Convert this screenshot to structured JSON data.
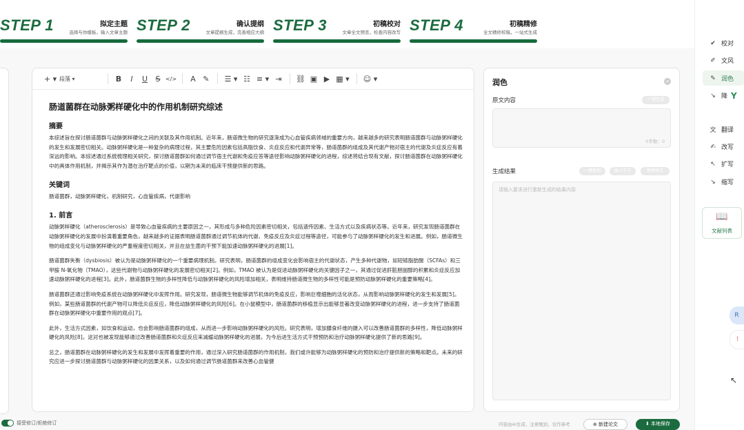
{
  "steps": [
    {
      "num": "STEP 1",
      "title": "拟定主题",
      "subtitle": "选择与你模板，输入文章主题"
    },
    {
      "num": "STEP 2",
      "title": "确认提纲",
      "subtitle": "文章提纲生成，完善相应大纲"
    },
    {
      "num": "STEP 3",
      "title": "初稿校对",
      "subtitle": "文章全文预览，检查内容改写"
    },
    {
      "num": "STEP 4",
      "title": "初稿精修",
      "subtitle": "全文精修校稿，一站式生成"
    }
  ],
  "toolbar": {
    "add": "+ ▾",
    "paragraph": "段落 ▾",
    "bold": "B",
    "italic": "I",
    "underline": "U",
    "strike": "S",
    "code": "</>",
    "font_color": "A",
    "highlight": "✎",
    "align": "☰ ▾",
    "list": "☷",
    "ordered_list": "≡ ▾",
    "indent": "⇥",
    "link": "⛓",
    "image": "▣",
    "video": "▶",
    "table": "▦ ▾",
    "emoji": "☺ ▾"
  },
  "document": {
    "title": "肠道菌群在动脉粥样硬化中的作用机制研究综述",
    "abstract_heading": "摘要",
    "abstract": "本综述旨在探讨肠道菌群与动脉粥样硬化之间的关联及其作用机制。近年来，肠道微生物的研究逐渐成为心血管疾病领域的重要方向，越来越多的研究表明肠道菌群与动脉粥样硬化的发生和发展密切相关。动脉粥样硬化是一种复杂的病理过程，其主要危险因素包括高脂饮食、炎症反应和代谢异常等，肠道菌群的组成及其代谢产物对宿主的代谢及炎症反应有着深远的影响。本综述通过系统梳理相关研究，探讨肠道菌群如何通过调节宿主代谢和免疫应答等途径影响动脉粥样硬化的进程，综述将结合现有文献，探讨肠道菌群在动脉粥样硬化中的具体作用机制，并揭示其作为潜在治疗靶点的价值，以期为未来的临床干预提供新的思路。",
    "keywords_heading": "关键词",
    "keywords": "肠道菌群，动脉粥样硬化，机制研究，心血管疾病，代谢影响",
    "section1_heading": "1. 前言",
    "paragraphs": [
      "动脉粥样硬化（atherosclerosis）是导致心血管疾病的主要原因之一，其形成与多种危险因素密切相关，包括遗传因素、生活方式以及疾病状态等。近年来，研究发现肠道菌群在动脉粥样硬化的发展中扮演着重要角色，越来越多的证据表明肠道菌群通过调节机体的代谢、免疫反应及炎症过程等途径，可能参与了动脉粥样硬化的发生和进展。例如，肠道微生物的组成变化与动脉粥样硬化的严重程度密切相关，并且在益生菌的干预下能加速动脉粥样硬化的进展[1]。",
      "肠道菌群失衡（dysbiosis）被认为是动脉粥样硬化的一个重要病理机制。研究表明，肠道菌群的组成变化会影响宿主的代谢状态，产生多种代谢物，如短链脂肪酸（SCFAs）和三甲胺 N-氧化物（TMAO），这些代谢物与动脉粥样硬化的发展密切相关[2]。例如，TMAO 被认为是促进动脉粥样硬化的关键因子之一，其通过促进肝脏胆固醇的积累和炎症反应加速动脉粥样硬化的进程[3]。此外，肠道菌群生物的多样性降低与动脉粥样硬化的风险增加相关，表明维持肠道微生物的多样性可能是预防动脉粥样硬化的重要策略[4]。",
      "肠道菌群还通过影响免疫系统在动脉粥样硬化中发挥作用。研究发现，肠道微生物能够调节机体的免疫反应，影响巨噬细胞的活化状态，从而影响动脉粥样硬化的发生和发展[5]。例如，某些肠道菌群的代谢产物可以降低炎症反应，降低动脉粥样硬化的风险[6]。在小鼠模型中，肠道菌群的移植显示出能够显著改变动脉粥样硬化的进程，进一步支持了肠道菌群在动脉粥样硬化中重要作用的观点[7]。",
      "此外，生活方式因素，如饮食和运动，也会影响肠道菌群的组成，从而进一步影响动脉粥样硬化的风险。研究表明，增加膳食纤维的摄入可以改善肠道菌群的多样性，降低动脉粥样硬化的风险[8]。这对也被发现能够通过改善肠道菌群和炎症反应来减缓动脉粥样硬化的进展，为今后进生活方式干预预防和治疗动脉粥样硬化提供了新的思路[9]。",
      "总之，肠道菌群在动脉粥样硬化的发生和发展中发挥着重要的作用，通过深入研究肠道菌群的作用机制，我们或许能够为动脉粥样硬化的预防和治疗提供新的策略和靶点。未来的研究应进一步探讨肠道菌群与动脉粥样硬化的因果关系，以及如何通过调节肠道菌群来改善心血管健"
    ]
  },
  "panel": {
    "title": "润色",
    "close": "×",
    "original_label": "原文内容",
    "one_click": "一键生成",
    "word_count": "0字数：0",
    "result_label": "生成结果",
    "replace_btn": "一键复制",
    "insert_btn": "插入下方",
    "replace_text_btn": "替换原文",
    "placeholder": "请输入要求进行重新生成的结果内容"
  },
  "sidebar": {
    "items": [
      {
        "icon": "✔",
        "label": "校对"
      },
      {
        "icon": "✐",
        "label": "文风"
      },
      {
        "icon": "✎",
        "label": "润色"
      },
      {
        "icon": "↘",
        "label": "降"
      },
      {
        "icon": "文",
        "label": "翻译"
      },
      {
        "icon": "✍",
        "label": "改写"
      },
      {
        "icon": "↖",
        "label": "扩写"
      },
      {
        "icon": "↘",
        "label": "缩写"
      }
    ],
    "logo": "Y",
    "library": "文献列表",
    "float1": "R",
    "float2": "⁝"
  },
  "footer": {
    "toggle_label": "接受修订/拒绝修订",
    "note": "内容由AI生成，注意甄别，仅作参考",
    "new_paper": "⊕ 新建论文",
    "save": "⬇ 本地保存"
  }
}
